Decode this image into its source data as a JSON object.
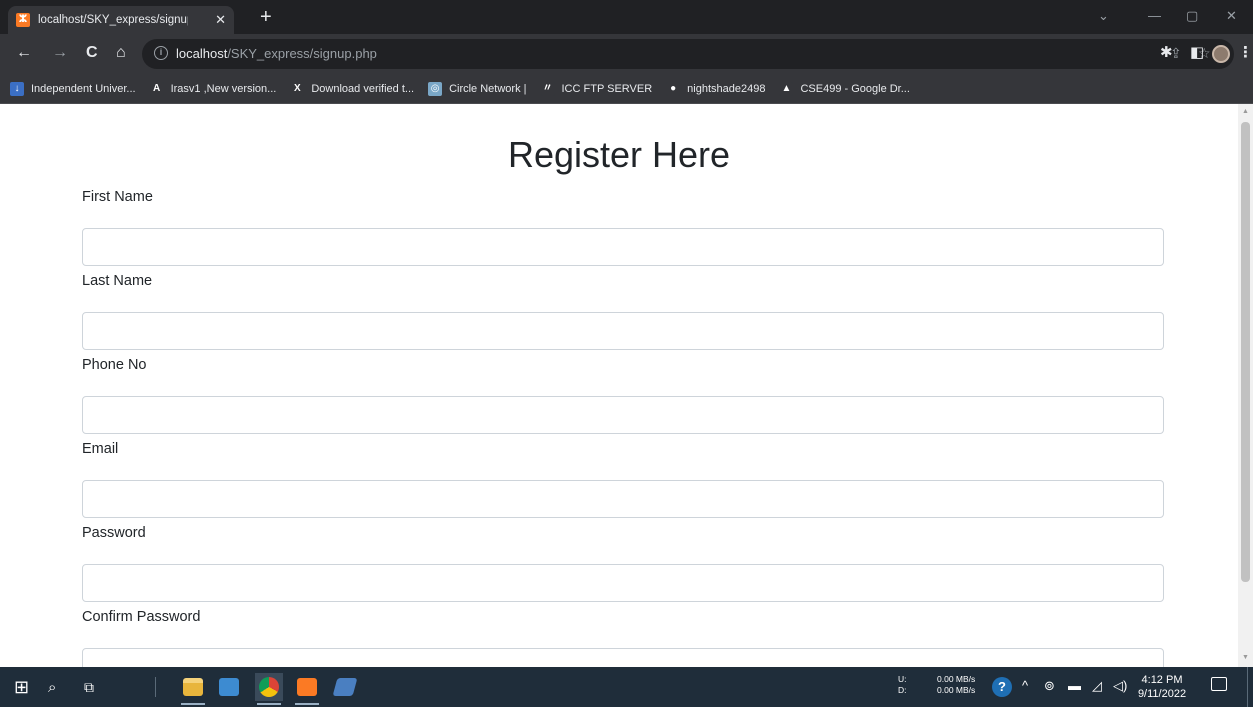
{
  "browser": {
    "tab": {
      "title": "localhost/SKY_express/signup.ph",
      "close": "✕"
    },
    "new_tab": "+",
    "window": {
      "tab_search": "⌄",
      "minimize": "—",
      "maximize": "▢",
      "close": "✕"
    },
    "nav": {
      "back": "←",
      "forward": "→",
      "reload": "C",
      "home": "⌂"
    },
    "url": {
      "host": "localhost",
      "path": "/SKY_express/signup.php"
    },
    "omni": {
      "info": "i",
      "share": "⇪",
      "star": "☆"
    },
    "toolbar_icons": {
      "extensions": "✱",
      "side_panel": "◧",
      "menu": "⋮"
    },
    "bookmarks": [
      {
        "label": "Independent Univer...",
        "icon": "university-icon",
        "color": "#3b6fc4",
        "glyph": "↓"
      },
      {
        "label": "Irasv1 ,New version...",
        "icon": "a-icon",
        "color": "#35363a",
        "glyph": "A"
      },
      {
        "label": "Download verified t...",
        "icon": "x-icon",
        "color": "#35363a",
        "glyph": "X"
      },
      {
        "label": "Circle Network |",
        "icon": "circle-network-icon",
        "color": "#7aa7c7",
        "glyph": "◎"
      },
      {
        "label": "ICC FTP SERVER",
        "icon": "icc-icon",
        "color": "#35363a",
        "glyph": "〃"
      },
      {
        "label": "nightshade2498",
        "icon": "github-icon",
        "color": "#35363a",
        "glyph": "●"
      },
      {
        "label": "CSE499 - Google Dr...",
        "icon": "google-drive-icon",
        "color": "#35363a",
        "glyph": "▲"
      }
    ]
  },
  "page": {
    "title": "Register Here",
    "fields": [
      {
        "label": "First Name",
        "value": "",
        "placeholder": ""
      },
      {
        "label": "Last Name",
        "value": "",
        "placeholder": ""
      },
      {
        "label": "Phone No",
        "value": "",
        "placeholder": ""
      },
      {
        "label": "Email",
        "value": "",
        "placeholder": ""
      },
      {
        "label": "Password",
        "value": "",
        "placeholder": ""
      },
      {
        "label": "Confirm Password",
        "value": "",
        "placeholder": ""
      }
    ]
  },
  "taskbar": {
    "start": "⊞",
    "search": "⌕",
    "task_view": "⧉",
    "tray": {
      "upload_label": "U:",
      "download_label": "D:",
      "upload_speed": "0.00 MB/s",
      "download_speed": "0.00 MB/s",
      "help": "?",
      "chevron": "^",
      "wifi": "⊚",
      "battery": "▬",
      "network": "◿",
      "volume": "◁)"
    },
    "clock": {
      "time": "4:12 PM",
      "date": "9/11/2022"
    }
  }
}
